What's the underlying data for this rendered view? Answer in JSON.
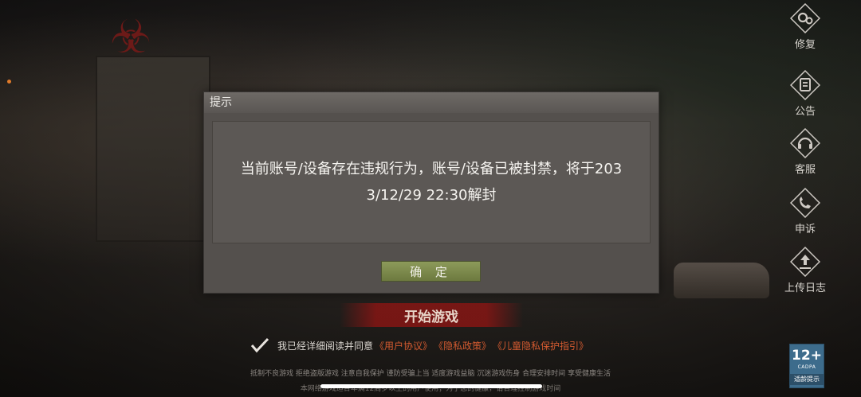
{
  "dialog": {
    "title": "提示",
    "message_line1": "当前账号/设备存在违规行为，账号/设备已被封禁，将于203",
    "message_line2": "3/12/29 22:30解封",
    "confirm_label": "确 定"
  },
  "side_menu": {
    "items": [
      {
        "label": "修复",
        "icon": "gear-icon"
      },
      {
        "label": "公告",
        "icon": "notice-icon"
      },
      {
        "label": "客服",
        "icon": "headset-icon"
      },
      {
        "label": "申诉",
        "icon": "phone-icon"
      },
      {
        "label": "上传日志",
        "icon": "upload-icon"
      }
    ]
  },
  "start_button_label": "开始游戏",
  "agreement": {
    "prefix": "我已经详细阅读并同意",
    "links": [
      "《用户协议》",
      "《隐私政策》",
      "《儿童隐私保护指引》"
    ]
  },
  "health_notice": "抵制不良游戏 拒绝盗版游戏 注意自我保护 谨防受骗上当 适度游戏益脑 沉迷游戏伤身 合理安排时间 享受健康生活",
  "copyright_notice": "本网络游戏适合年满12周岁以上的用户使用；为了您的健康，请合理控制游戏时间",
  "age_rating": {
    "age": "12+",
    "org": "CADPA",
    "hint": "适龄提示"
  },
  "colors": {
    "dialog_bg": "#54504d",
    "confirm_button": "#7d8a4c",
    "start_button": "#801614",
    "link": "#d25a30"
  }
}
